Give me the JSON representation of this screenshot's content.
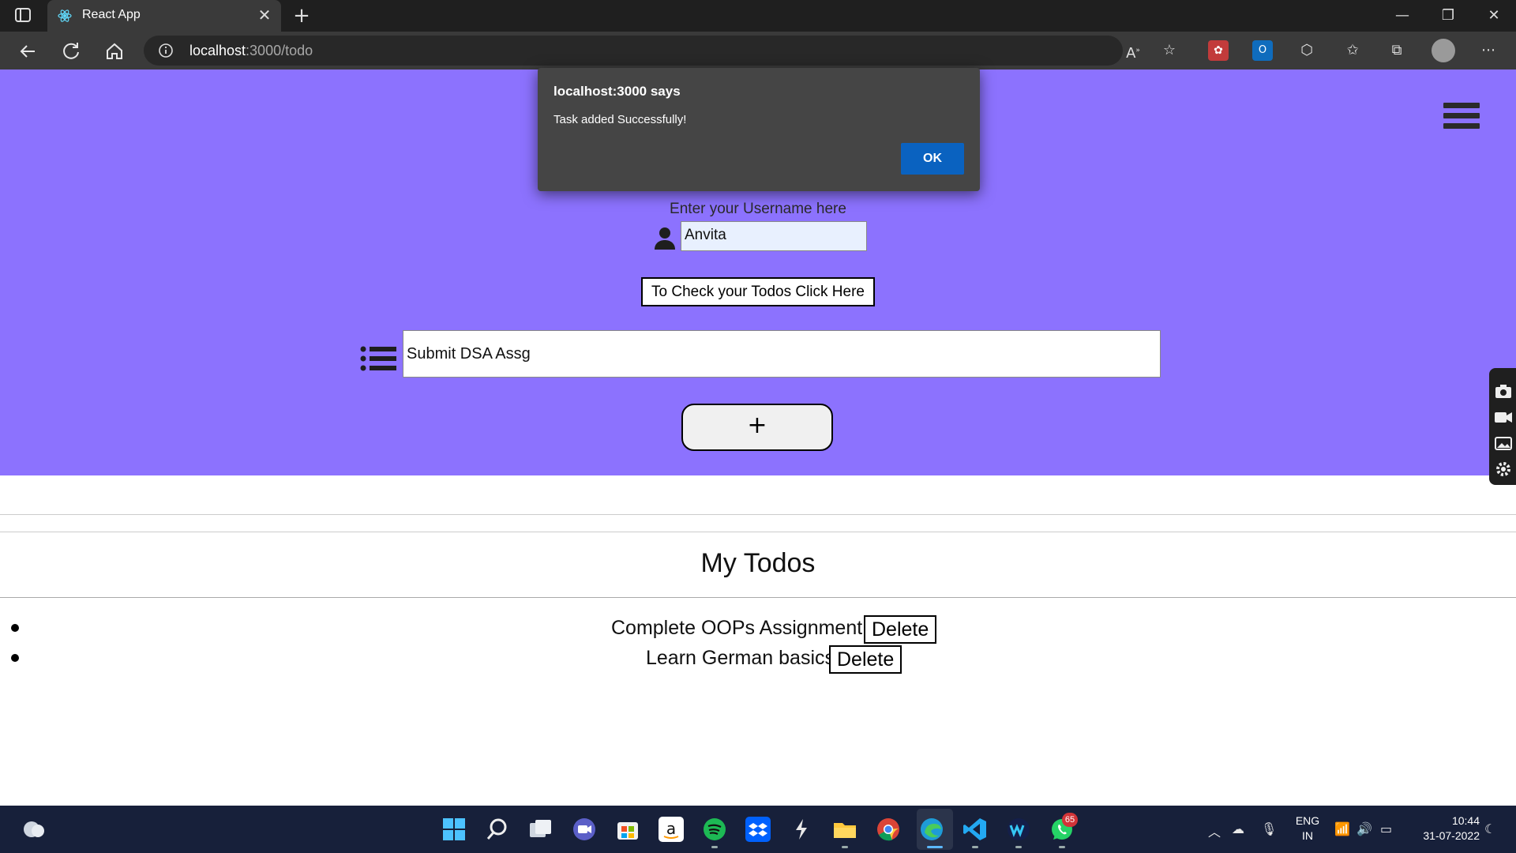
{
  "browser": {
    "tab_title": "React App",
    "url_host": "localhost",
    "url_rest": ":3000/todo"
  },
  "dialog": {
    "title": "localhost:3000 says",
    "message": "Task added Successfully!",
    "ok_label": "OK"
  },
  "page": {
    "username_label": "Enter your Username here",
    "username_value": "Anvita",
    "check_button": "To Check your Todos Click Here",
    "task_input_value": "Submit DSA Assg",
    "add_button": "+",
    "todos_heading": "My Todos",
    "todos": [
      {
        "text": "Complete OOPs Assignment",
        "delete_label": "Delete"
      },
      {
        "text": "Learn German basics",
        "delete_label": "Delete"
      }
    ],
    "accent_color": "#8c72fe"
  },
  "taskbar": {
    "apps": [
      "start-icon",
      "search-icon",
      "task-view-icon",
      "chat-icon",
      "store-icon",
      "amazon-icon",
      "spotify-icon",
      "dropbox-icon",
      "dev-tool-icon",
      "file-explorer-icon",
      "chrome-icon",
      "edge-icon",
      "vscode-icon",
      "webex-icon",
      "whatsapp-icon"
    ],
    "whatsapp_badge": "65",
    "lang_line1": "ENG",
    "lang_line2": "IN",
    "time": "10:44",
    "date": "31-07-2022"
  }
}
